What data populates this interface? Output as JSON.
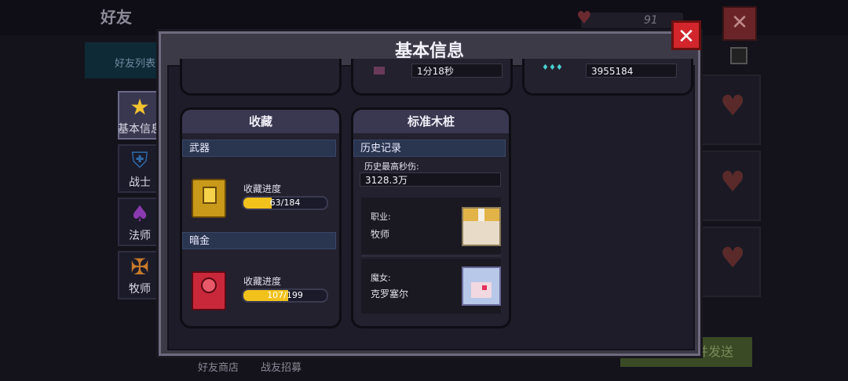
{
  "background": {
    "title": "好友",
    "tab_label": "好友列表",
    "heart_count": "91",
    "send_label": "并发送",
    "bottom_left": "好友商店",
    "bottom_right": "战友招募"
  },
  "sidebar": {
    "items": [
      {
        "label": "基本信息",
        "icon": "star-icon",
        "active": true
      },
      {
        "label": "战士",
        "icon": "warrior-icon",
        "active": false
      },
      {
        "label": "法师",
        "icon": "mage-icon",
        "active": false
      },
      {
        "label": "牧师",
        "icon": "priest-icon",
        "active": false
      }
    ]
  },
  "panel": {
    "title": "基本信息",
    "close_label": "✕",
    "top_row": {
      "time_value": "1分18秒",
      "number_value": "3955184"
    },
    "collection": {
      "title": "收藏",
      "weapons": {
        "section": "武器",
        "progress_label": "收藏进度",
        "current": 63,
        "total": 184,
        "text": "63/184"
      },
      "dark_gold": {
        "section": "暗金",
        "progress_label": "收藏进度",
        "current": 107,
        "total": 199,
        "text": "107/199"
      }
    },
    "stake": {
      "title": "标准木桩",
      "history_label": "历史记录",
      "max_dps_label": "历史最高秒伤:",
      "max_dps_value": "3128.3万",
      "class_label": "职业:",
      "class_value": "牧师",
      "witch_label": "魔女:",
      "witch_value": "克罗塞尔"
    }
  },
  "colors": {
    "accent_close": "#d2252c",
    "progress_fill": "#f2c21c",
    "section_bar": "#2a3550"
  }
}
